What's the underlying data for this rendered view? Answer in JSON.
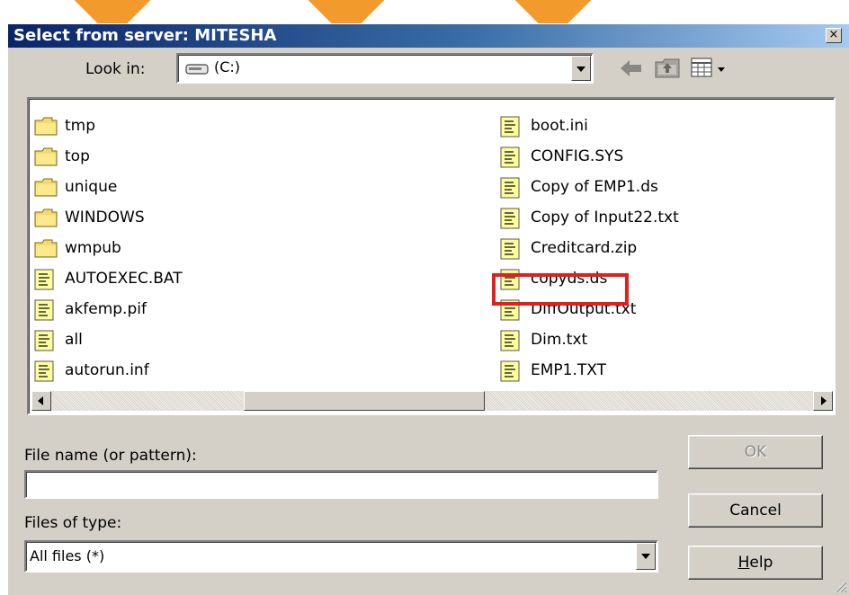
{
  "dialog": {
    "title": "Select from server: MITESHA",
    "close_label": "×"
  },
  "lookin": {
    "label": "Look in:",
    "value": "(C:)",
    "drive_icon": "drive-icon"
  },
  "toolbar": {
    "back_icon": "back-arrow-icon",
    "up_icon": "up-folder-icon",
    "views_icon": "view-menu-icon"
  },
  "files": {
    "left": [
      {
        "name": "tmp",
        "type": "folder"
      },
      {
        "name": "top",
        "type": "folder"
      },
      {
        "name": "unique",
        "type": "folder"
      },
      {
        "name": "WINDOWS",
        "type": "folder"
      },
      {
        "name": "wmpub",
        "type": "folder"
      },
      {
        "name": "AUTOEXEC.BAT",
        "type": "file"
      },
      {
        "name": "akfemp.pif",
        "type": "file"
      },
      {
        "name": "all",
        "type": "file"
      },
      {
        "name": "autorun.inf",
        "type": "file"
      }
    ],
    "right": [
      {
        "name": "boot.ini",
        "type": "file"
      },
      {
        "name": "CONFIG.SYS",
        "type": "file"
      },
      {
        "name": "Copy of EMP1.ds",
        "type": "file"
      },
      {
        "name": "Copy of Input22.txt",
        "type": "file"
      },
      {
        "name": "Creditcard.zip",
        "type": "file"
      },
      {
        "name": "copyds.ds",
        "type": "file",
        "highlighted": true
      },
      {
        "name": "DiffOutput.txt",
        "type": "file"
      },
      {
        "name": "Dim.txt",
        "type": "file"
      },
      {
        "name": "EMP1.TXT",
        "type": "file"
      }
    ]
  },
  "form": {
    "filename_label": "File name (or pattern):",
    "filename_value": "",
    "filetype_label": "Files of type:",
    "filetype_value": "All files (*)"
  },
  "buttons": {
    "ok": "OK",
    "cancel": "Cancel",
    "help": "Help"
  },
  "colors": {
    "highlight": "#e0201e",
    "title_start": "#0a246a",
    "dialog_bg": "#d4d0c8"
  }
}
